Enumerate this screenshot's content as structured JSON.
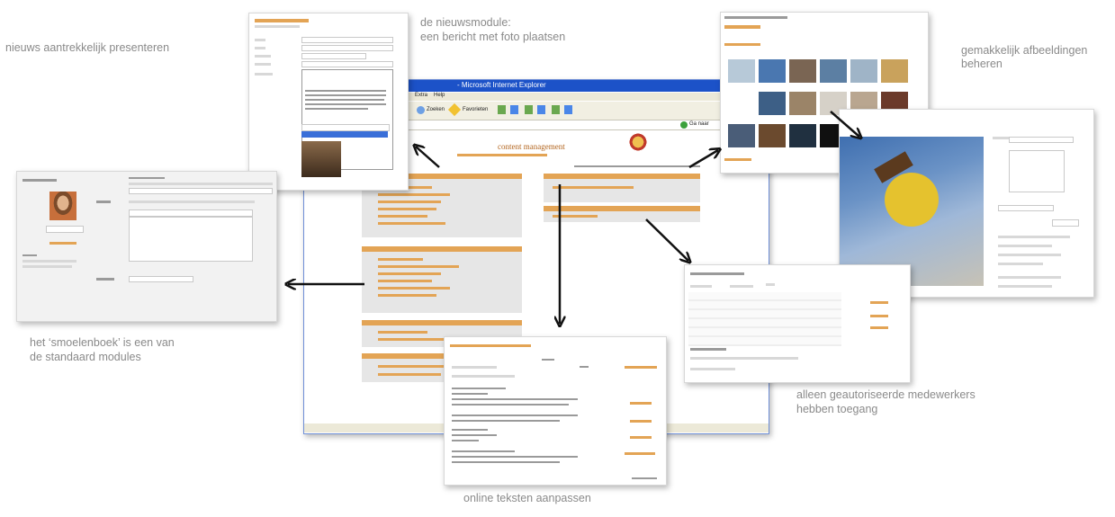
{
  "captions": {
    "news_attractive": "nieuws aantrekkelijk presenteren",
    "news_module_line1": "de nieuwsmodule:",
    "news_module_line2": "een bericht met foto plaatsen",
    "images_line1": "gemakkelijk afbeeldingen",
    "images_line2": "beheren",
    "smoelenboek_line1": "het ‘smoelenboek’ is een van",
    "smoelenboek_line2": "de standaard modules",
    "authorized_line1": "alleen geautoriseerde medewerkers",
    "authorized_line2": "hebben toegang",
    "online_texts": "online teksten aanpassen"
  },
  "browser": {
    "title": "- Microsoft Internet Explorer",
    "menu": [
      "Extra",
      "Help"
    ],
    "toolbar": [
      "Zoeken",
      "Favorieten"
    ],
    "go_label": "Ga naar",
    "site_logo": "content management"
  },
  "colors": {
    "accent_orange": "#e0a04a",
    "ie_titlebar": "#1c52c8",
    "arrow": "#111111"
  }
}
